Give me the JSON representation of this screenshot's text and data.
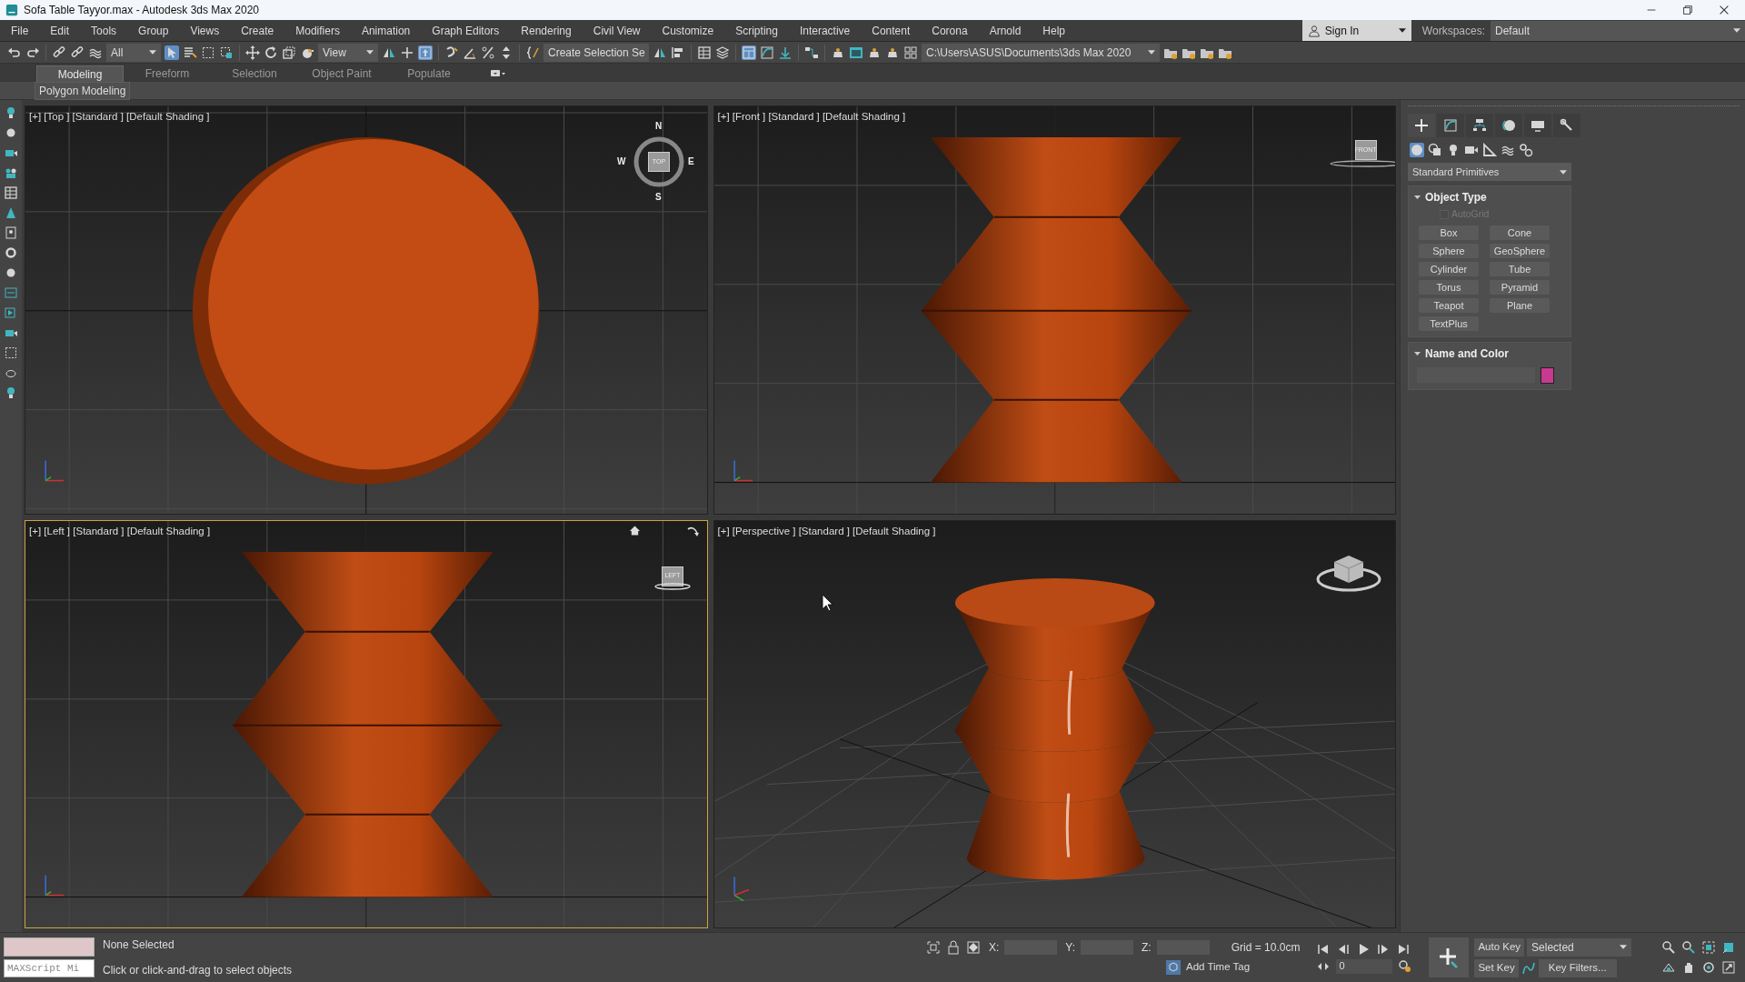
{
  "window": {
    "title": "Sofa Table Tayyor.max - Autodesk 3ds Max 2020"
  },
  "menu": [
    "File",
    "Edit",
    "Tools",
    "Group",
    "Views",
    "Create",
    "Modifiers",
    "Animation",
    "Graph Editors",
    "Rendering",
    "Civil View",
    "Customize",
    "Scripting",
    "Interactive",
    "Content",
    "Corona",
    "Arnold",
    "Help"
  ],
  "account": {
    "sign_in": "Sign In",
    "workspaces_label": "Workspaces:",
    "workspace": "Default"
  },
  "toolbar": {
    "selection_filter": "All",
    "reference_coordinate": "View",
    "named_selection": "Create Selection Se",
    "project_folder": "C:\\Users\\ASUS\\Documents\\3ds Max 2020",
    "select_object_on": true,
    "pivot_on": true,
    "scene_explorer_on": true
  },
  "ribbon": {
    "tabs": [
      {
        "label": "Modeling",
        "selected": true
      },
      {
        "label": "Freeform",
        "selected": false
      },
      {
        "label": "Selection",
        "selected": false
      },
      {
        "label": "Object Paint",
        "selected": false
      },
      {
        "label": "Populate",
        "selected": false
      }
    ],
    "panel": "Polygon Modeling"
  },
  "viewports": [
    {
      "kind": "top",
      "label": "[+] [Top ] [Standard ] [Default Shading ]",
      "active": false,
      "cube_label": "TOP",
      "compass": [
        "N",
        "W",
        "E",
        "S"
      ]
    },
    {
      "kind": "front",
      "label": "[+] [Front ] [Standard ] [Default Shading ]",
      "active": false,
      "cube_label": "FRONT"
    },
    {
      "kind": "left",
      "label": "[+] [Left ] [Standard ] [Default Shading ]",
      "active": true,
      "cube_label": "LEFT"
    },
    {
      "kind": "perspective",
      "label": "[+] [Perspective ] [Standard ] [Default Shading ]",
      "active": false
    }
  ],
  "command_panel": {
    "tabs": [
      {
        "selected": true
      },
      {
        "selected": false
      },
      {
        "selected": false
      },
      {
        "selected": false
      },
      {
        "selected": false
      },
      {
        "selected": false
      }
    ],
    "categories": [
      {
        "selected": true
      },
      {
        "selected": false
      },
      {
        "selected": false
      },
      {
        "selected": false
      },
      {
        "selected": false
      },
      {
        "selected": false
      },
      {
        "selected": false
      }
    ],
    "type": "Standard Primitives",
    "object_type": {
      "title": "Object Type",
      "autogrid": {
        "label": "AutoGrid",
        "checked": false,
        "disabled": true
      },
      "buttons": [
        "Box",
        "Cone",
        "Sphere",
        "GeoSphere",
        "Cylinder",
        "Tube",
        "Torus",
        "Pyramid",
        "Teapot",
        "Plane",
        "TextPlus"
      ]
    },
    "name_and_color": {
      "title": "Name and Color"
    }
  },
  "status": {
    "listener_placeholder": "MAXScript Mi",
    "selection": "None Selected",
    "prompt": "Click or click-and-drag to select objects",
    "x_label": "X:",
    "y_label": "Y:",
    "z_label": "Z:",
    "grid": "Grid = 10.0cm",
    "time_tag": "Add Time Tag",
    "frame": "0",
    "auto_key": "Auto Key",
    "key_mode": "Selected",
    "set_key": "Set Key",
    "key_filters": "Key Filters..."
  }
}
